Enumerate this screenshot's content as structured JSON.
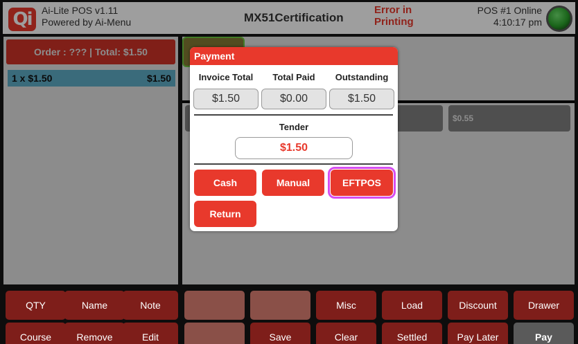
{
  "header": {
    "app_name": "Ai-Lite POS v1.11",
    "app_sub": "Powered by Ai-Menu",
    "store_title": "MX51Certification",
    "error_text": "Error in Printing",
    "pos_status": "POS #1 Online",
    "time": "4:10:17 pm",
    "logo_text": "Qi"
  },
  "order": {
    "header": "Order : ??? | Total: $1.50",
    "line_qty": "1 x $1.50",
    "line_amount": "$1.50"
  },
  "main": {
    "tile_price": "$0.55"
  },
  "bottom_buttons": {
    "row1": [
      "QTY",
      "Name",
      "Note",
      "",
      "",
      "Misc",
      "Load",
      "Discount",
      "Drawer"
    ],
    "row2": [
      "Course",
      "Remove",
      "Edit",
      "",
      "Save",
      "Clear",
      "Settled",
      "Pay Later",
      "Pay"
    ]
  },
  "payment": {
    "title": "Payment",
    "invoice_total_label": "Invoice Total",
    "total_paid_label": "Total Paid",
    "outstanding_label": "Outstanding",
    "invoice_total": "$1.50",
    "total_paid": "$0.00",
    "outstanding": "$1.50",
    "tender_label": "Tender",
    "tender_value": "$1.50",
    "cash_label": "Cash",
    "manual_label": "Manual",
    "eftpos_label": "EFTPOS",
    "return_label": "Return"
  },
  "colors": {
    "brand_red": "#e8392c",
    "highlight": "#d64df0",
    "status_green": "#2aa22a"
  }
}
